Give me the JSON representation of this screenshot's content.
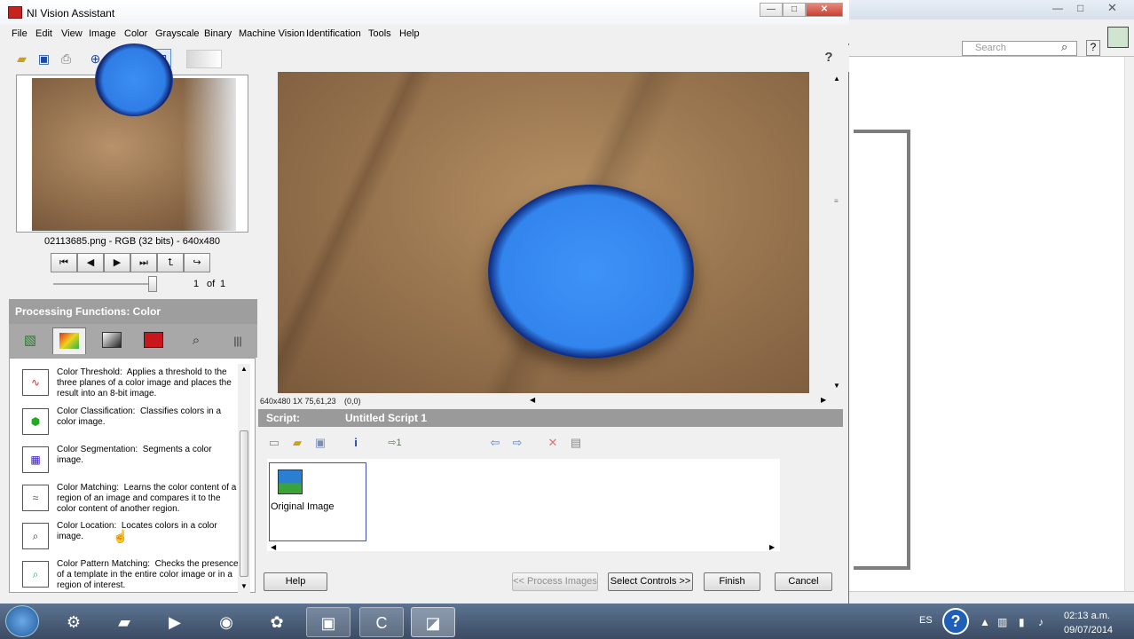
{
  "window": {
    "title": "NI Vision Assistant",
    "minimize": "—",
    "maximize": "□",
    "close": "✕"
  },
  "menu": [
    "File",
    "Edit",
    "View",
    "Image",
    "Color",
    "Grayscale",
    "Binary",
    "Machine Vision",
    "Identification",
    "Tools",
    "Help"
  ],
  "toolbar": {
    "icons": [
      "open-icon",
      "save-icon",
      "print-icon",
      "zoom-in-icon",
      "zoom-out-icon",
      "zoom-1to1-icon",
      "zoom-fit-icon"
    ],
    "help_glyph": "?"
  },
  "browser": {
    "image_info": "02113685.png - RGB (32 bits) - 640x480",
    "nav_buttons": [
      "⏮",
      "◀",
      "▶",
      "⏭",
      "⮤",
      "↪"
    ],
    "page_current": "1",
    "page_of": "of",
    "page_total": "1"
  },
  "processing": {
    "header": "Processing Functions: Color",
    "categories": [
      "image-category-icon",
      "color-category-icon",
      "grayscale-category-icon",
      "binary-category-icon",
      "machine-vision-category-icon",
      "identification-category-icon"
    ],
    "selected_category": "Color",
    "functions": [
      {
        "title": "Color Threshold:",
        "desc": "Applies a threshold to the three planes of a color image and places the result into an 8-bit image."
      },
      {
        "title": "Color Classification:",
        "desc": "Classifies colors in a color image."
      },
      {
        "title": "Color Segmentation:",
        "desc": "Segments a color image."
      },
      {
        "title": "Color Matching:",
        "desc": "Learns the color content of a region of an image and compares it to the color content of another region."
      },
      {
        "title": "Color Location:",
        "desc": "Locates colors in a color image."
      },
      {
        "title": "Color Pattern Matching:",
        "desc": "Checks the presence of a template in the entire color image or in a region of interest."
      }
    ]
  },
  "image_view": {
    "status": "640x480 1X 75,61,23",
    "coord": "(0,0)"
  },
  "script": {
    "label": "Script:",
    "name": "Untitled Script 1",
    "run_step_label": "1",
    "steps": [
      {
        "label": "Original Image"
      }
    ]
  },
  "buttons": {
    "help": "Help",
    "process": "<< Process Images",
    "select_controls": "Select Controls >>",
    "finish": "Finish",
    "cancel": "Cancel"
  },
  "background_window": {
    "search_placeholder": "Search"
  },
  "taskbar": {
    "lang": "ES",
    "time": "02:13 a.m.",
    "date": "09/07/2014"
  },
  "colors": {
    "header_gray": "#9e9e9e",
    "disc_blue": "#3385ee",
    "step_border": "#3a52b8"
  }
}
